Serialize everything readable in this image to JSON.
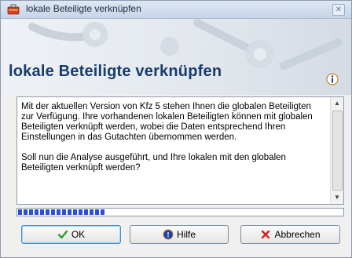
{
  "window": {
    "title": "lokale Beteiligte verknüpfen",
    "close_glyph": "✕",
    "app_icon": "toolbox-icon"
  },
  "header": {
    "title": "lokale Beteiligte verknüpfen",
    "info_icon": "info-icon"
  },
  "message": {
    "paragraph1": "Mit der aktuellen Version von Kfz 5 stehen Ihnen die globalen Beteiligten zur Verfügung. Ihre vorhandenen lokalen Beteiligten können mit globalen Beteiligten verknüpft werden, wobei die Daten entsprechend Ihren Einstellungen in das Gutachten übernommen werden.",
    "paragraph2": "Soll nun die Analyse ausgeführt, und Ihre lokalen mit den globalen Beteiligten verknüpft werden?"
  },
  "scrollbar": {
    "up_glyph": "▲",
    "down_glyph": "▼"
  },
  "progress": {
    "fraction": 0.27
  },
  "buttons": {
    "ok_label": "OK",
    "help_label": "Hilfe",
    "cancel_label": "Abbrechen"
  },
  "colors": {
    "header_title": "#173b6d",
    "progress_fill": "#2f4fd8",
    "ok_check": "#2e9a2e",
    "cancel_x": "#d62020",
    "help_icon": "#1f3fa8"
  }
}
